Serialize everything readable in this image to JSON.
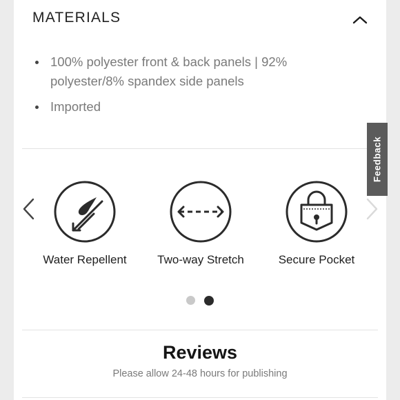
{
  "materials": {
    "title": "MATERIALS",
    "items": [
      "100% polyester front & back panels | 92% polyester/8% spandex side panels",
      "Imported"
    ]
  },
  "feedback": {
    "label": "Feedback"
  },
  "features": {
    "items": [
      {
        "label": "Water Repellent",
        "icon": "water-repellent-icon"
      },
      {
        "label": "Two-way Stretch",
        "icon": "two-way-stretch-icon"
      },
      {
        "label": "Secure Pocket",
        "icon": "secure-pocket-icon"
      }
    ],
    "pagination": {
      "active": 2
    }
  },
  "reviews": {
    "title": "Reviews",
    "subtitle": "Please allow 24-48 hours for publishing"
  },
  "colors": {
    "icon_stroke": "#2b2b2b",
    "muted_text": "#7a7a7a",
    "feedback_bg": "#5b5b5b",
    "dot_inactive": "#c9c9c9",
    "dot_active": "#2b2b2b"
  }
}
